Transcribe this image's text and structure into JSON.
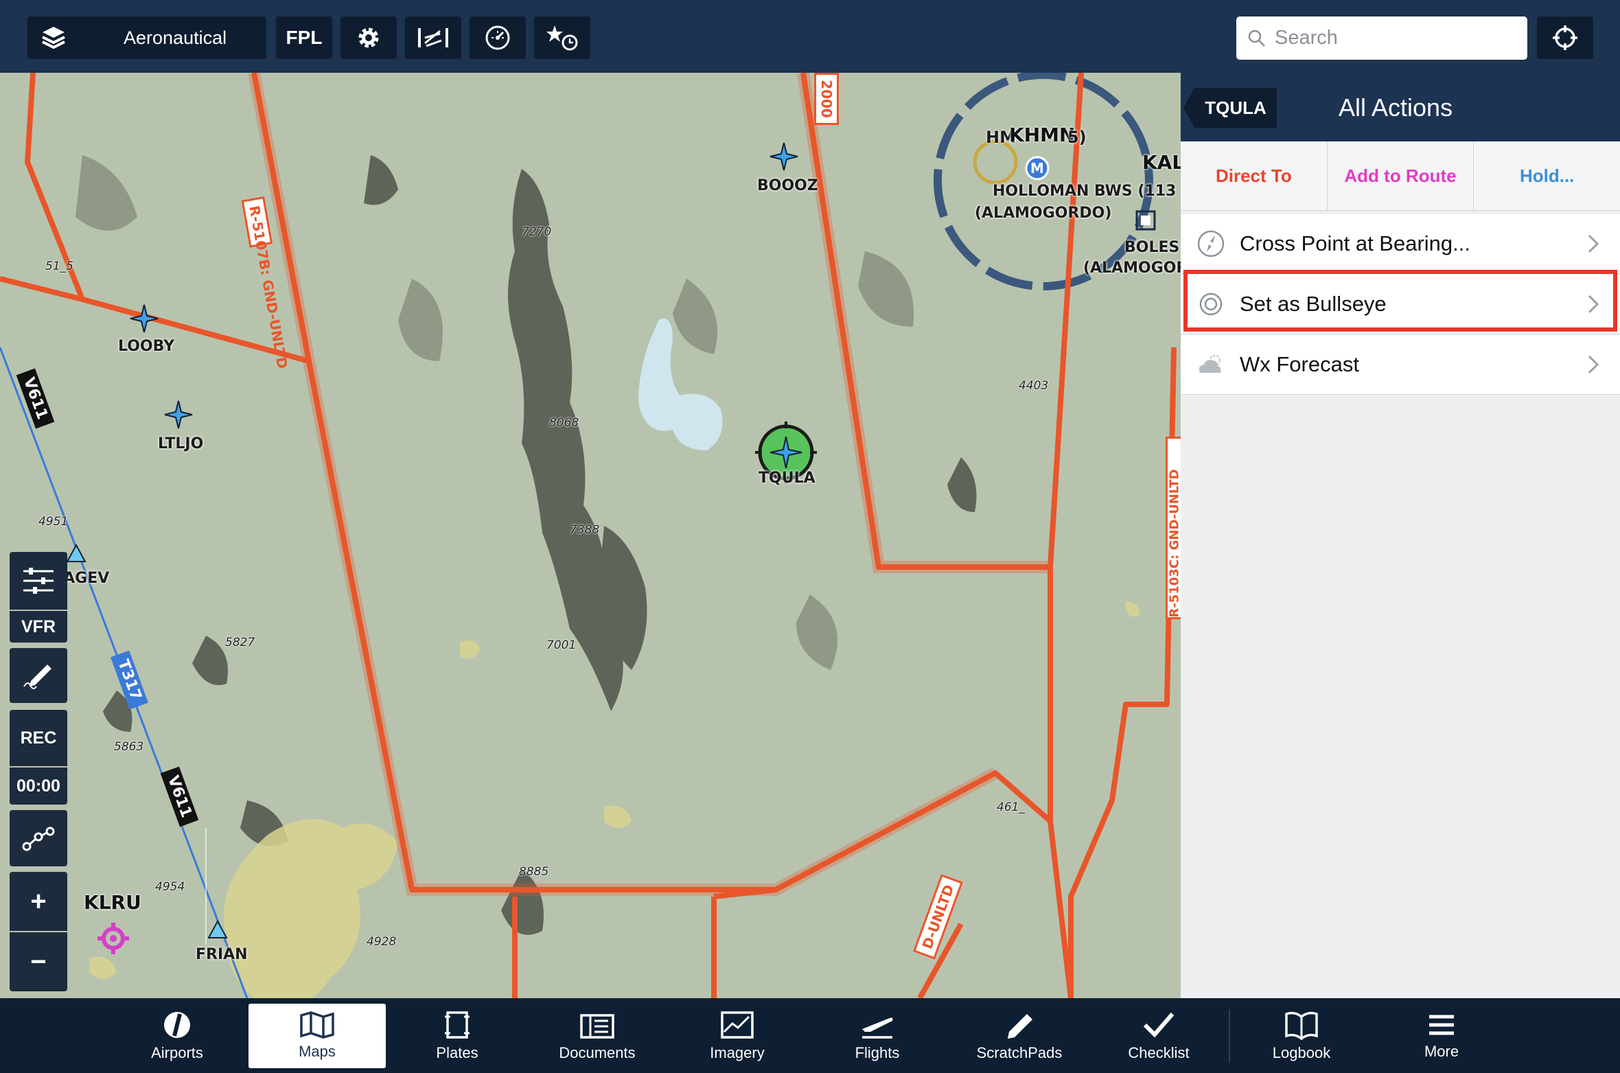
{
  "topbar": {
    "layers_label": "Aeronautical",
    "fpl_label": "FPL",
    "search_placeholder": "Search"
  },
  "map": {
    "waypoints": [
      "BOOOZ",
      "LOOBY",
      "LTLJO",
      "TQULA",
      "CAGEV",
      "FRIAN"
    ],
    "airports": [
      "KLRU",
      "KHMN"
    ],
    "airport_details": [
      "HOLLOMAN BWS (113",
      "(ALAMOGORDO)",
      "BOLES",
      "(ALAMOGOR",
      "HM",
      "5)",
      "KAL"
    ],
    "airspace_labels": [
      "R-5107B: GND-UNLTD",
      "R-5103C: GND-UNLTD",
      "D-UNLTD",
      "2000"
    ],
    "airways": [
      "V611",
      "T317",
      "V611"
    ],
    "elevations": [
      "7270",
      "51_5",
      "8068",
      "4403",
      "4951",
      "7388",
      "5827",
      "7001",
      "5863",
      "461_",
      "8885",
      "4954",
      "4928"
    ],
    "tools": {
      "vfr": "VFR",
      "rec": "REC",
      "timer": "00:00",
      "plus": "+",
      "minus": "−"
    }
  },
  "panel": {
    "waypoint": "TQULA",
    "title": "All Actions",
    "actions": [
      {
        "label": "Direct To",
        "color": "#e8462a"
      },
      {
        "label": "Add to Route",
        "color": "#e03cc8"
      },
      {
        "label": "Hold...",
        "color": "#3c8fd8"
      }
    ],
    "rows": [
      {
        "label": "Cross Point at Bearing...",
        "icon": "compass-icon"
      },
      {
        "label": "Set as Bullseye",
        "icon": "bullseye-icon"
      },
      {
        "label": "Wx Forecast",
        "icon": "weather-icon"
      }
    ]
  },
  "bottombar": {
    "tabs": [
      "Airports",
      "Maps",
      "Plates",
      "Documents",
      "Imagery",
      "Flights",
      "ScratchPads",
      "Checklist",
      "Logbook",
      "More"
    ],
    "active": "Maps"
  },
  "colors": {
    "navy": "#1c3352",
    "airspace": "#e8562a",
    "highlight": "#e8352a",
    "terrain": "#b9c4b0"
  }
}
